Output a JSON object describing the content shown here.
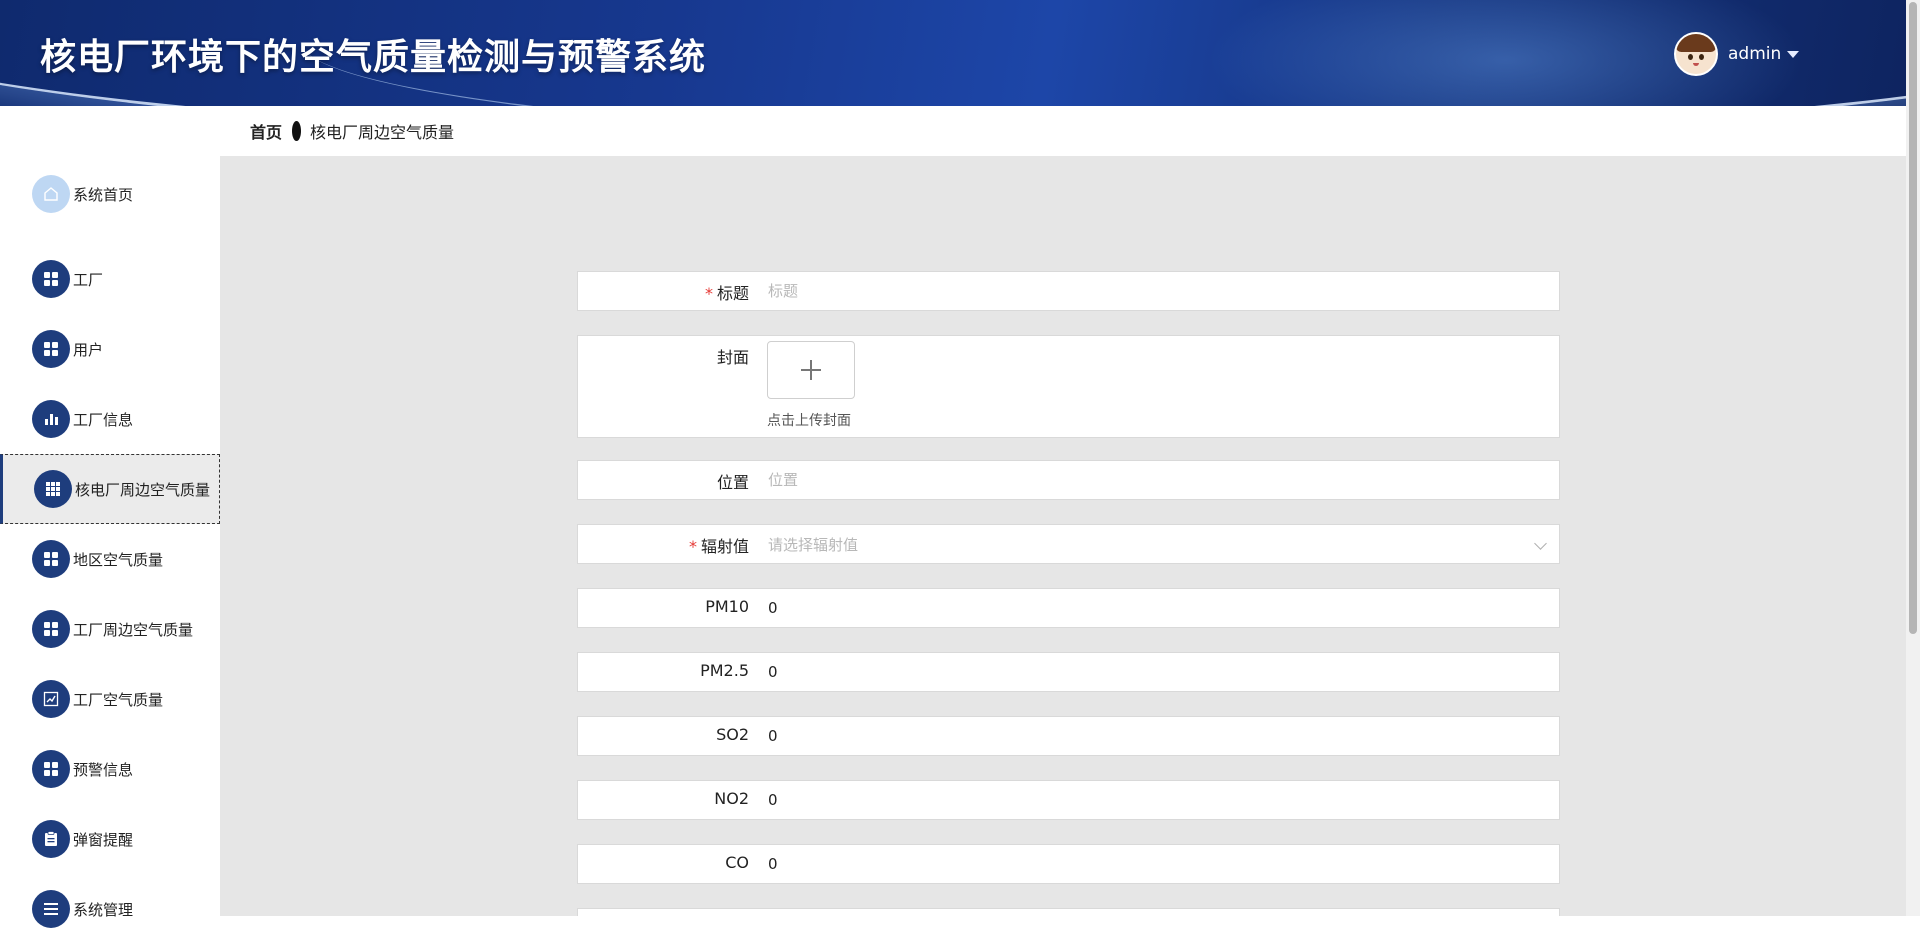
{
  "app": {
    "title": "核电厂环境下的空气质量检测与预警系统"
  },
  "user": {
    "name": "admin"
  },
  "breadcrumb": {
    "home": "首页",
    "current": "核电厂周边空气质量"
  },
  "sidebar": {
    "items": [
      {
        "label": "系统首页",
        "icon": "home-icon"
      },
      {
        "label": "工厂",
        "icon": "grid-icon"
      },
      {
        "label": "用户",
        "icon": "grid-icon"
      },
      {
        "label": "工厂信息",
        "icon": "bar-chart-icon"
      },
      {
        "label": "核电厂周边空气质量",
        "icon": "table-icon",
        "active": true
      },
      {
        "label": "地区空气质量",
        "icon": "grid-icon"
      },
      {
        "label": "工厂周边空气质量",
        "icon": "grid-icon"
      },
      {
        "label": "工厂空气质量",
        "icon": "line-chart-icon"
      },
      {
        "label": "预警信息",
        "icon": "grid-icon"
      },
      {
        "label": "弹窗提醒",
        "icon": "clipboard-icon"
      },
      {
        "label": "系统管理",
        "icon": "list-icon"
      }
    ]
  },
  "form": {
    "title": {
      "label": "标题",
      "placeholder": "标题",
      "required": true
    },
    "cover": {
      "label": "封面",
      "hint": "点击上传封面"
    },
    "location": {
      "label": "位置",
      "placeholder": "位置"
    },
    "radiation": {
      "label": "辐射值",
      "placeholder": "请选择辐射值",
      "required": true
    },
    "pm10": {
      "label": "PM10",
      "value": "0"
    },
    "pm25": {
      "label": "PM2.5",
      "value": "0"
    },
    "so2": {
      "label": "SO2",
      "value": "0"
    },
    "no2": {
      "label": "NO2",
      "value": "0"
    },
    "co": {
      "label": "CO",
      "value": "0"
    }
  },
  "colors": {
    "header": "#17388f",
    "nav_icon": "#1e3d7d",
    "required": "#e53935",
    "main_bg": "#e6e6e6"
  }
}
